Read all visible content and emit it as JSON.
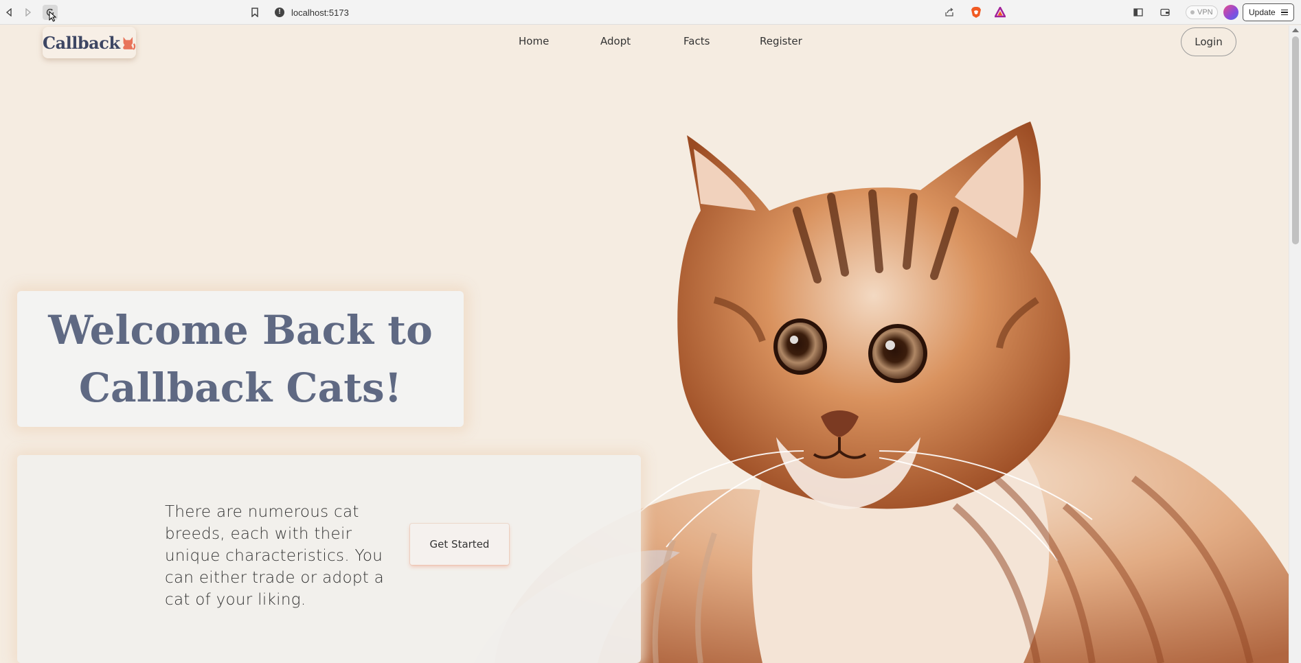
{
  "browser": {
    "url": "localhost:5173",
    "vpn_label": "VPN",
    "update_label": "Update",
    "icons": [
      "back-icon",
      "forward-icon",
      "reload-icon",
      "bookmark-icon",
      "info-icon",
      "share-icon",
      "brave-shield-icon",
      "rewards-icon",
      "sidebar-icon",
      "wallet-icon",
      "menu-icon"
    ]
  },
  "site": {
    "logo_text": "Callback",
    "logo_icon": "cat-silhouette-icon",
    "logo_icon_color": "#e8735a",
    "nav": {
      "home": "Home",
      "adopt": "Adopt",
      "facts": "Facts",
      "register": "Register"
    },
    "login_label": "Login"
  },
  "hero": {
    "title_line1": "Welcome Back to",
    "title_line2": "Callback Cats!",
    "title_color": "#5f6983"
  },
  "info": {
    "description": "There are numerous cat breeds, each with their unique characteristics. You can either trade or adopt a cat of your liking.",
    "cta_label": "Get Started"
  },
  "colors": {
    "page_background": "#f5ece1",
    "card_background": "#f3f3f2",
    "accent": "#e8735a"
  }
}
